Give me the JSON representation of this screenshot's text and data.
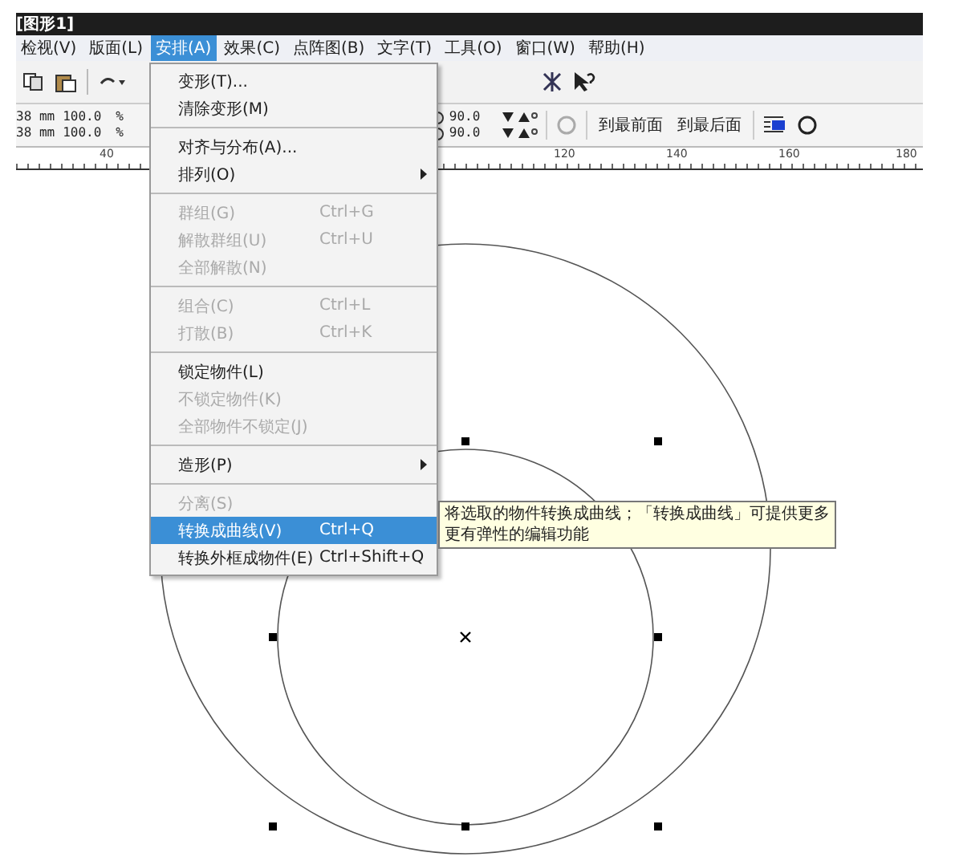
{
  "window": {
    "title": "[图形1]"
  },
  "menubar": [
    {
      "label": "检视(V)",
      "selected": false
    },
    {
      "label": "版面(L)",
      "selected": false
    },
    {
      "label": "安排(A)",
      "selected": true
    },
    {
      "label": "效果(C)",
      "selected": false
    },
    {
      "label": "点阵图(B)",
      "selected": false
    },
    {
      "label": "文字(T)",
      "selected": false
    },
    {
      "label": "工具(O)",
      "selected": false
    },
    {
      "label": "窗口(W)",
      "selected": false
    },
    {
      "label": "帮助(H)",
      "selected": false
    }
  ],
  "property_bar": {
    "sizes": [
      "38 mm",
      "38 mm"
    ],
    "scales": [
      "100.0",
      "100.0"
    ],
    "scale_units": [
      "%",
      "%"
    ],
    "angles": [
      "90.0",
      "90.0"
    ],
    "buttons": [
      "到最前面",
      "到最后面"
    ]
  },
  "ruler": {
    "labels": [
      "40",
      "120",
      "140",
      "160",
      "180"
    ]
  },
  "menu": {
    "groups": [
      [
        {
          "label": "变形(T)...",
          "disabled": false,
          "selected": false,
          "submenu": false
        },
        {
          "label": "清除变形(M)",
          "disabled": false,
          "selected": false,
          "submenu": false
        }
      ],
      [
        {
          "label": "对齐与分布(A)...",
          "disabled": false,
          "selected": false,
          "submenu": false
        },
        {
          "label": "排列(O)",
          "disabled": false,
          "selected": false,
          "submenu": true
        }
      ],
      [
        {
          "label": "群组(G)",
          "shortcut": "Ctrl+G",
          "disabled": true,
          "selected": false,
          "submenu": false
        },
        {
          "label": "解散群组(U)",
          "shortcut": "Ctrl+U",
          "disabled": true,
          "selected": false,
          "submenu": false
        },
        {
          "label": "全部解散(N)",
          "disabled": true,
          "selected": false,
          "submenu": false
        }
      ],
      [
        {
          "label": "组合(C)",
          "shortcut": "Ctrl+L",
          "disabled": true,
          "selected": false,
          "submenu": false
        },
        {
          "label": "打散(B)",
          "shortcut": "Ctrl+K",
          "disabled": true,
          "selected": false,
          "submenu": false
        }
      ],
      [
        {
          "label": "锁定物件(L)",
          "disabled": false,
          "selected": false,
          "submenu": false
        },
        {
          "label": "不锁定物件(K)",
          "disabled": true,
          "selected": false,
          "submenu": false
        },
        {
          "label": "全部物件不锁定(J)",
          "disabled": true,
          "selected": false,
          "submenu": false
        }
      ],
      [
        {
          "label": "造形(P)",
          "disabled": false,
          "selected": false,
          "submenu": true
        }
      ],
      [
        {
          "label": "分离(S)",
          "disabled": true,
          "selected": false,
          "submenu": false
        },
        {
          "label": "转换成曲线(V)",
          "shortcut": "Ctrl+Q",
          "disabled": false,
          "selected": true,
          "submenu": false
        },
        {
          "label": "转换外框成物件(E)",
          "shortcut": "Ctrl+Shift+Q",
          "disabled": false,
          "selected": false,
          "submenu": false
        }
      ]
    ]
  },
  "tooltip": {
    "text": "将选取的物件转换成曲线；「转换成曲线」可提供更多更有弹性的编辑功能"
  }
}
